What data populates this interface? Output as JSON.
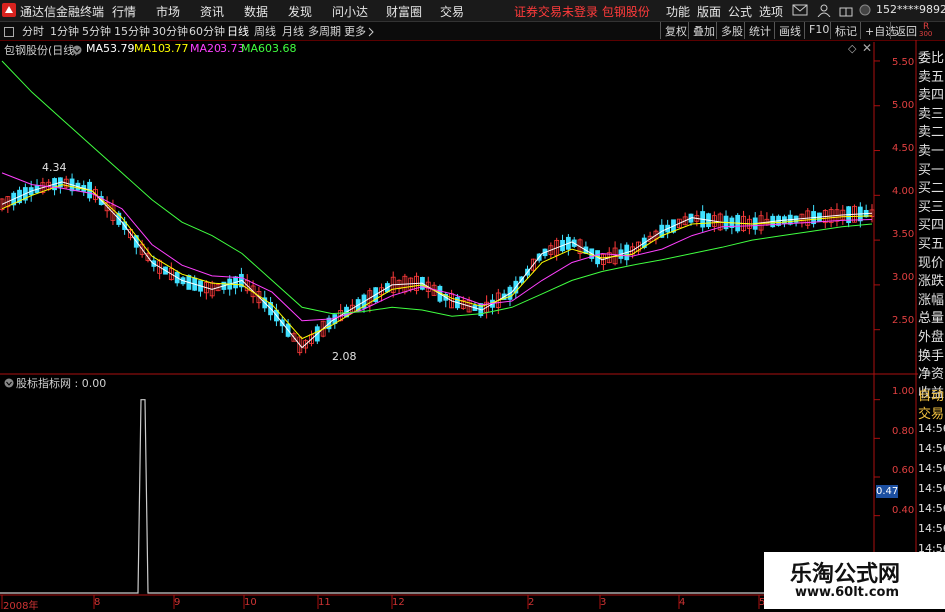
{
  "titlebar": {
    "app_title": "通达信金融终端",
    "menus": [
      "行情",
      "市场",
      "资讯",
      "数据",
      "发现",
      "问小达",
      "财富圈",
      "交易"
    ],
    "promo": "证券交易未登录  包钢股份",
    "right_menus": [
      "功能",
      "版面",
      "公式",
      "选项"
    ],
    "phone": "152****9892",
    "window_buttons": [
      "─",
      "□",
      "✕"
    ]
  },
  "toolbar": {
    "periods": [
      "分时",
      "1分钟",
      "5分钟",
      "15分钟",
      "30分钟",
      "60分钟",
      "日线",
      "周线",
      "月线",
      "多周期",
      "更多"
    ],
    "active_period": "日线",
    "buttons": [
      "复权",
      "叠加",
      "多股",
      "统计",
      "画线",
      "F10",
      "标记",
      "+自选",
      "返回"
    ]
  },
  "main_chart": {
    "stock_label": "包钢股份(日线)",
    "ma": [
      {
        "name": "MA5",
        "value": "3.79",
        "color": "#ffffff"
      },
      {
        "name": "MA10",
        "value": "3.77",
        "color": "#ffff00"
      },
      {
        "name": "MA20",
        "value": "3.73",
        "color": "#ff40ff"
      },
      {
        "name": "MA60",
        "value": "3.68",
        "color": "#40ff40"
      }
    ],
    "high_label": "4.34",
    "low_label": "2.08",
    "r_label": "R",
    "r_sub": "300"
  },
  "sub_chart": {
    "label": "股标指标网 : 0.00",
    "badge": "0.47"
  },
  "right_panel": {
    "items": [
      "委比",
      "卖五",
      "卖四",
      "卖三",
      "卖二",
      "卖一",
      "买一",
      "买二",
      "买三",
      "买四",
      "买五",
      "现价",
      "涨跌",
      "涨幅",
      "总量",
      "外盘",
      "换手",
      "净资",
      "收益"
    ],
    "lower_items": [
      "自动",
      "交易"
    ],
    "times": [
      "14:56",
      "14:56",
      "14:56",
      "14:56",
      "14:56",
      "14:56",
      "14:56",
      "14:56"
    ]
  },
  "watermark": {
    "title": "乐淘公式网",
    "url": "www.60lt.com"
  },
  "colors": {
    "up": "#ff3b3b",
    "down": "#40e0ff",
    "ma5": "#ffffff",
    "ma10": "#ffff00",
    "ma20": "#ff40ff",
    "ma60": "#40ff40",
    "axis": "#aa1010"
  },
  "chart_data": [
    {
      "type": "candlestick",
      "title": "包钢股份(日线)",
      "ylim": [
        2.05,
        5.6
      ],
      "y_ticks": [
        "5.50",
        "5.00",
        "4.50",
        "4.00",
        "3.50",
        "3.00",
        "2.50"
      ],
      "x_ticks": [
        "2008年",
        "8",
        "9",
        "10",
        "11",
        "12",
        "2",
        "3",
        "4",
        "5"
      ],
      "annotations": [
        {
          "text": "4.34",
          "value": 4.34
        },
        {
          "text": "2.08",
          "value": 2.08
        }
      ],
      "series": [
        {
          "name": "MA5",
          "color": "#ffffff",
          "values": [
            3.9,
            4.05,
            4.15,
            4.05,
            3.7,
            3.25,
            3.05,
            2.95,
            3.05,
            2.72,
            2.3,
            2.6,
            2.8,
            3.0,
            3.02,
            2.82,
            2.72,
            2.92,
            3.35,
            3.48,
            3.28,
            3.38,
            3.6,
            3.75,
            3.7,
            3.68,
            3.72,
            3.75,
            3.78,
            3.8
          ]
        },
        {
          "name": "MA10",
          "color": "#ffff00",
          "values": [
            3.85,
            4.0,
            4.12,
            4.05,
            3.75,
            3.32,
            3.12,
            3.02,
            3.0,
            2.78,
            2.4,
            2.55,
            2.75,
            2.95,
            3.0,
            2.85,
            2.76,
            2.88,
            3.25,
            3.4,
            3.3,
            3.34,
            3.55,
            3.68,
            3.7,
            3.68,
            3.7,
            3.73,
            3.76,
            3.77
          ]
        },
        {
          "name": "MA20",
          "color": "#ff40ff",
          "values": [
            4.25,
            4.12,
            4.08,
            4.02,
            3.85,
            3.45,
            3.22,
            3.1,
            3.08,
            2.92,
            2.6,
            2.62,
            2.72,
            2.88,
            2.98,
            2.9,
            2.78,
            2.82,
            3.05,
            3.25,
            3.35,
            3.32,
            3.4,
            3.55,
            3.65,
            3.66,
            3.68,
            3.7,
            3.72,
            3.73
          ]
        },
        {
          "name": "MA60",
          "color": "#40ff40",
          "values": [
            5.5,
            5.15,
            4.85,
            4.55,
            4.25,
            3.95,
            3.7,
            3.55,
            3.35,
            3.05,
            2.75,
            2.68,
            2.7,
            2.75,
            2.72,
            2.65,
            2.68,
            2.75,
            2.9,
            3.05,
            3.15,
            3.22,
            3.28,
            3.35,
            3.42,
            3.5,
            3.55,
            3.6,
            3.65,
            3.68
          ]
        }
      ]
    },
    {
      "type": "line",
      "title": "股标指标网",
      "ylim": [
        0,
        1.05
      ],
      "y_ticks": [
        "1.00",
        "0.80",
        "0.60",
        "0.40"
      ],
      "series": [
        {
          "name": "股标指标网",
          "color": "#cccccc",
          "values": [
            0,
            0,
            0,
            0,
            0,
            0,
            0,
            1.0,
            0,
            0,
            0,
            0,
            0,
            0,
            0,
            0,
            0,
            0,
            0,
            0,
            0,
            0,
            0,
            0,
            0,
            0,
            0,
            0,
            0,
            0
          ]
        }
      ]
    }
  ]
}
